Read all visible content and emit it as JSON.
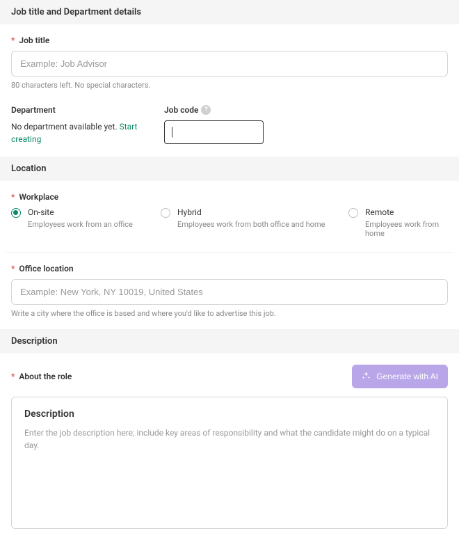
{
  "sections": {
    "jobTitle": {
      "header": "Job title and Department details",
      "jobTitleLabel": "Job title",
      "jobTitlePlaceholder": "Example: Job Advisor",
      "jobTitleHint": "80 characters left. No special characters.",
      "departmentLabel": "Department",
      "departmentEmptyText": "No department available yet. ",
      "departmentLinkText": "Start creating",
      "jobCodeLabel": "Job code"
    },
    "location": {
      "header": "Location",
      "workplaceLabel": "Workplace",
      "options": [
        {
          "value": "onsite",
          "title": "On-site",
          "desc": "Employees work from an office",
          "selected": true
        },
        {
          "value": "hybrid",
          "title": "Hybrid",
          "desc": "Employees work from both office and home",
          "selected": false
        },
        {
          "value": "remote",
          "title": "Remote",
          "desc": "Employees work from home",
          "selected": false
        }
      ],
      "officeLocationLabel": "Office location",
      "officeLocationPlaceholder": "Example: New York, NY 10019, United States",
      "officeLocationHint": "Write a city where the office is based and where you'd like to advertise this job."
    },
    "description": {
      "header": "Description",
      "aboutRoleLabel": "About the role",
      "generateButton": "Generate with AI",
      "descBoxTitle": "Description",
      "descBoxPlaceholder": "Enter the job description here; include key areas of responsibility and what the candidate might do on a typical day."
    }
  }
}
